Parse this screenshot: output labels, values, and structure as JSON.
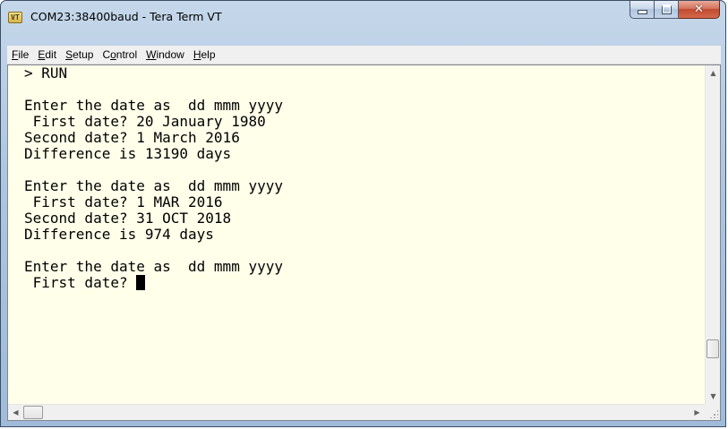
{
  "window": {
    "title": "COM23:38400baud - Tera Term VT",
    "app_icon": "tera-term-icon",
    "app_icon_glyph": "VT",
    "close_glyph": "✕"
  },
  "menu": {
    "items": [
      {
        "underline": "F",
        "rest": "ile"
      },
      {
        "underline": "E",
        "rest": "dit"
      },
      {
        "underline": "S",
        "rest": "etup"
      },
      {
        "pre": "C",
        "underline": "o",
        "rest": "ntrol"
      },
      {
        "underline": "W",
        "rest": "indow"
      },
      {
        "underline": "H",
        "rest": "elp"
      }
    ]
  },
  "terminal": {
    "background": "#ffffea",
    "lines": [
      "> RUN",
      "",
      "Enter the date as  dd mmm yyyy",
      " First date? 20 January 1980",
      "Second date? 1 March 2016",
      "Difference is 13190 days",
      "",
      "Enter the date as  dd mmm yyyy",
      " First date? 1 MAR 2016",
      "Second date? 31 OCT 2018",
      "Difference is 974 days",
      "",
      "Enter the date as  dd mmm yyyy",
      " First date? "
    ]
  },
  "scrollbars": {
    "up_arrow": "▲",
    "down_arrow": "▼",
    "left_arrow": "◀",
    "right_arrow": "▶"
  }
}
